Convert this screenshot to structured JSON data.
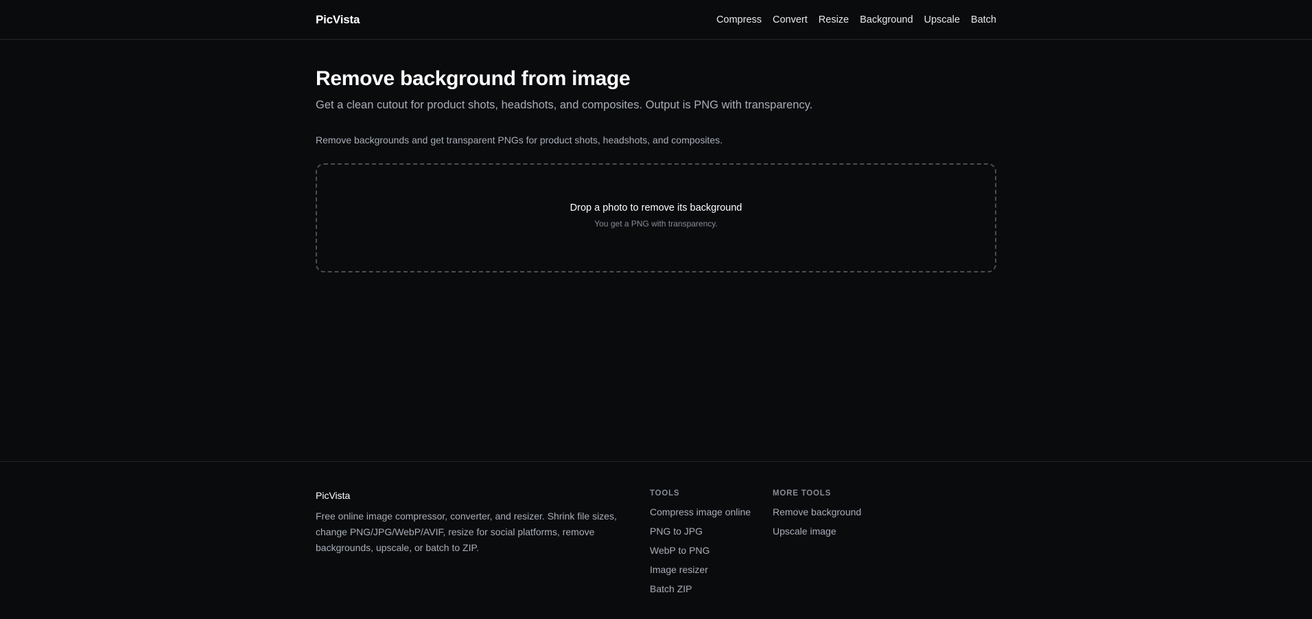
{
  "header": {
    "brand": "PicVista",
    "nav": [
      "Compress",
      "Convert",
      "Resize",
      "Background",
      "Upscale",
      "Batch"
    ]
  },
  "main": {
    "title": "Remove background from image",
    "subtitle": "Get a clean cutout for product shots, headshots, and composites. Output is PNG with transparency.",
    "intro": "Remove backgrounds and get transparent PNGs for product shots, headshots, and composites.",
    "dropzone": {
      "title": "Drop a photo to remove its background",
      "subtitle": "You get a PNG with transparency."
    }
  },
  "footer": {
    "brand": "PicVista",
    "description": "Free online image compressor, converter, and resizer. Shrink file sizes, change PNG/JPG/WebP/AVIF, resize for social platforms, remove backgrounds, upscale, or batch to ZIP.",
    "tools": {
      "heading": "TOOLS",
      "links": [
        "Compress image online",
        "PNG to JPG",
        "WebP to PNG",
        "Image resizer",
        "Batch ZIP"
      ]
    },
    "more_tools": {
      "heading": "MORE TOOLS",
      "links": [
        "Remove background",
        "Upscale image"
      ]
    }
  },
  "colors": {
    "background": "#0a0b0d",
    "text_primary": "#ffffff",
    "text_muted": "#a8adb7",
    "border": "#25272c",
    "dropzone_border": "#4a4d54"
  }
}
